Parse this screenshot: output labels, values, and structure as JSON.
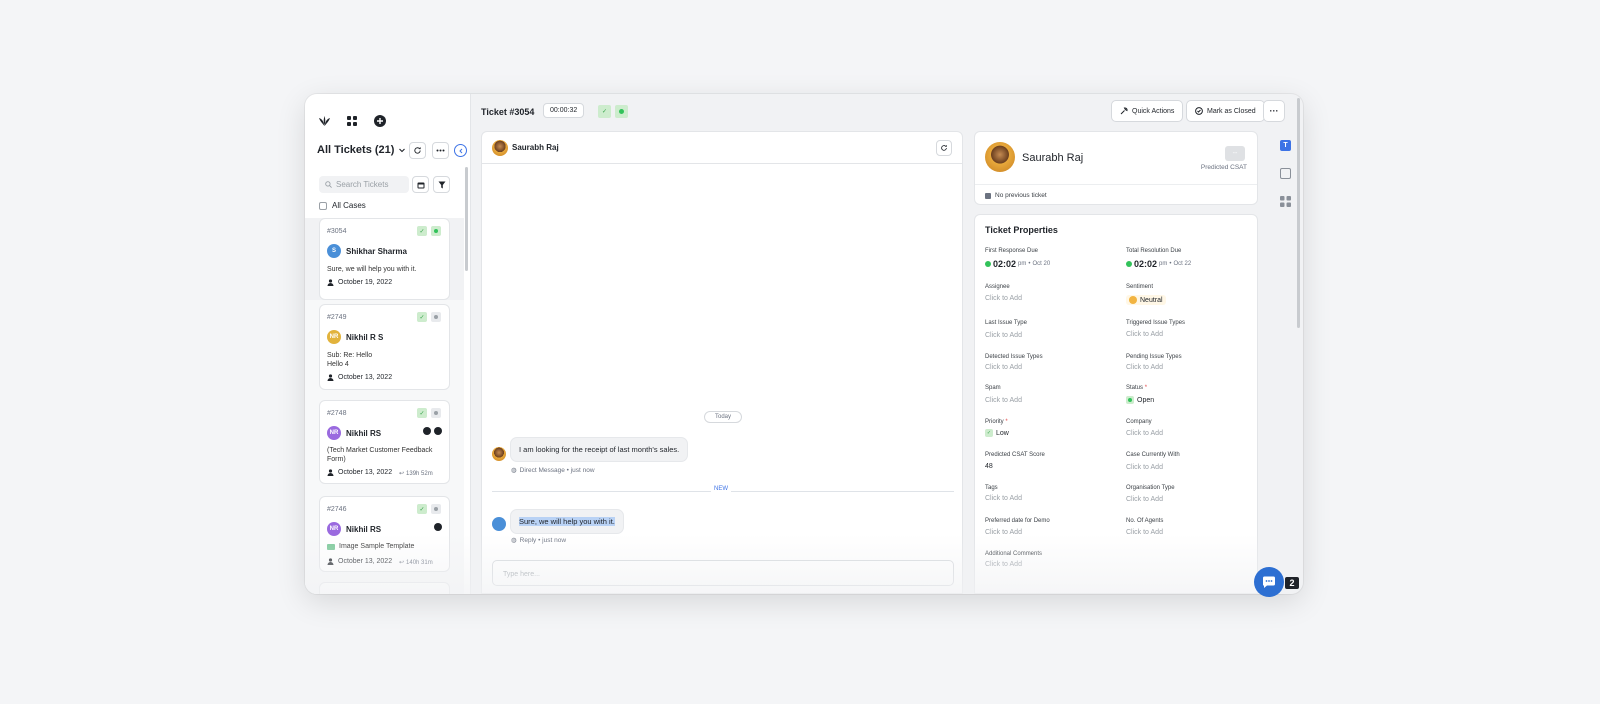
{
  "header": {
    "ticket_number": "Ticket #3054",
    "timer": "00:00:32",
    "quick_actions": "Quick Actions",
    "mark_closed": "Mark as Closed",
    "more": "···"
  },
  "sidebar": {
    "title": "All Tickets (21)",
    "search_placeholder": "Search Tickets",
    "all_cases": "All Cases"
  },
  "tickets": [
    {
      "id": "#3054",
      "initials": "S",
      "name": "Shikhar Sharma",
      "msg": "Sure, we will help you with it.",
      "date": "October 19, 2022"
    },
    {
      "id": "#2749",
      "initials": "NR",
      "name": "Nikhil R S",
      "msg1": "Sub: Re: Hello",
      "msg2": "Hello 4",
      "date": "October 13, 2022"
    },
    {
      "id": "#2748",
      "initials": "NR",
      "name": "Nikhil RS",
      "msg1": "(Tech Market Customer Feedback",
      "msg2": "Form)",
      "date": "October 13, 2022",
      "sla": "139h 52m"
    },
    {
      "id": "#2746",
      "initials": "NR",
      "name": "Nikhil RS",
      "msg": "Image Sample Template",
      "date": "October 13, 2022",
      "sla": "140h 31m"
    }
  ],
  "conversation": {
    "contact": "Saurabh Raj",
    "today": "Today",
    "msg1": "I am looking for the receipt of last month's sales.",
    "msg1_meta": "Direct Message • just now",
    "new": "NEW",
    "msg2": "Sure, we will help you with it.",
    "msg2_meta": "Reply • just now",
    "reply_placeholder": "Type here..."
  },
  "profile": {
    "name": "Saurabh Raj",
    "csat_label": "Predicted CSAT",
    "csat_btn": "--",
    "prev": "No previous ticket"
  },
  "properties": {
    "title": "Ticket Properties",
    "first_response_label": "First Response Due",
    "first_response_time": "02:02",
    "first_response_ampm": "pm",
    "first_response_date": "Oct 20",
    "total_resolution_label": "Total Resolution Due",
    "total_resolution_time": "02:02",
    "total_resolution_ampm": "pm",
    "total_resolution_date": "Oct 22",
    "assignee_label": "Assignee",
    "click_add": "Click to Add",
    "sentiment_label": "Sentiment",
    "sentiment_value": "Neutral",
    "last_issue_label": "Last Issue Type",
    "triggered_label": "Triggered Issue Types",
    "detected_label": "Detected Issue Types",
    "pending_label": "Pending Issue Types",
    "spam_label": "Spam",
    "status_label": "Status",
    "status_value": "Open",
    "priority_label": "Priority",
    "priority_value": "Low",
    "company_label": "Company",
    "pcsat_label": "Predicted CSAT Score",
    "pcsat_value": "48",
    "case_with_label": "Case Currently With",
    "tags_label": "Tags",
    "org_label": "Organisation Type",
    "pref_label": "Preferred date for Demo",
    "agents_label": "No. Of Agents",
    "comments_label": "Additional Comments"
  },
  "chat_badge": "2",
  "colors": {
    "accent": "#3d73e6",
    "green": "#32c25a",
    "chat": "#2d6fd2"
  }
}
